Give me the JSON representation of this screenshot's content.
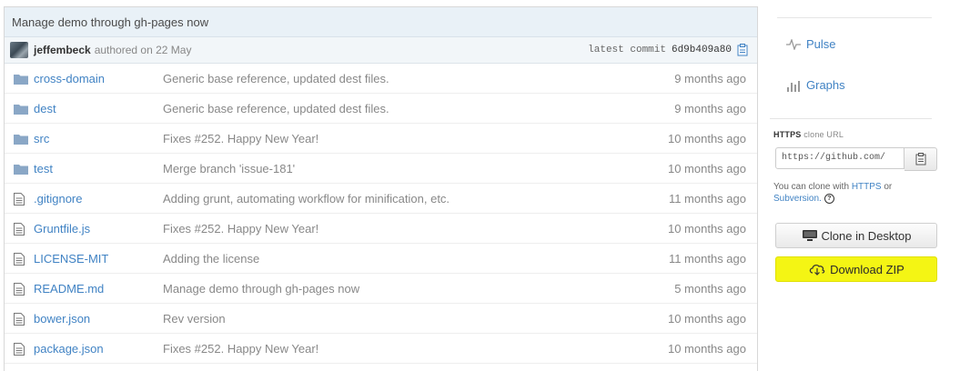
{
  "commit": {
    "message": "Manage demo through gh-pages now",
    "author": "jeffembeck",
    "authored_text": "authored on 22 May",
    "latest_label": "latest commit",
    "sha": "6d9b409a80"
  },
  "files": [
    {
      "type": "folder",
      "name": "cross-domain",
      "message": "Generic base reference, updated dest files.",
      "age": "9 months ago"
    },
    {
      "type": "folder",
      "name": "dest",
      "message": "Generic base reference, updated dest files.",
      "age": "9 months ago"
    },
    {
      "type": "folder",
      "name": "src",
      "message": "Fixes #252. Happy New Year!",
      "age": "10 months ago"
    },
    {
      "type": "folder",
      "name": "test",
      "message": "Merge branch 'issue-181'",
      "age": "10 months ago"
    },
    {
      "type": "file",
      "name": ".gitignore",
      "message": "Adding grunt, automating workflow for minification, etc.",
      "age": "11 months ago"
    },
    {
      "type": "file",
      "name": "Gruntfile.js",
      "message": "Fixes #252. Happy New Year!",
      "age": "10 months ago"
    },
    {
      "type": "file",
      "name": "LICENSE-MIT",
      "message": "Adding the license",
      "age": "11 months ago"
    },
    {
      "type": "file",
      "name": "README.md",
      "message": "Manage demo through gh-pages now",
      "age": "5 months ago"
    },
    {
      "type": "file",
      "name": "bower.json",
      "message": "Rev version",
      "age": "10 months ago"
    },
    {
      "type": "file",
      "name": "package.json",
      "message": "Fixes #252. Happy New Year!",
      "age": "10 months ago"
    }
  ],
  "sidebar": {
    "pulse": "Pulse",
    "graphs": "Graphs",
    "clone_protocol": "HTTPS",
    "clone_label": "clone URL",
    "clone_url": "https://github.com/",
    "help_prefix": "You can clone with",
    "help_https": "HTTPS",
    "help_or": "or",
    "help_subversion": "Subversion.",
    "clone_desktop": "Clone in Desktop",
    "download_zip": "Download ZIP"
  },
  "colors": {
    "link": "#4183c4",
    "highlight": "#f4f514",
    "folder": "#8aa7c6"
  }
}
